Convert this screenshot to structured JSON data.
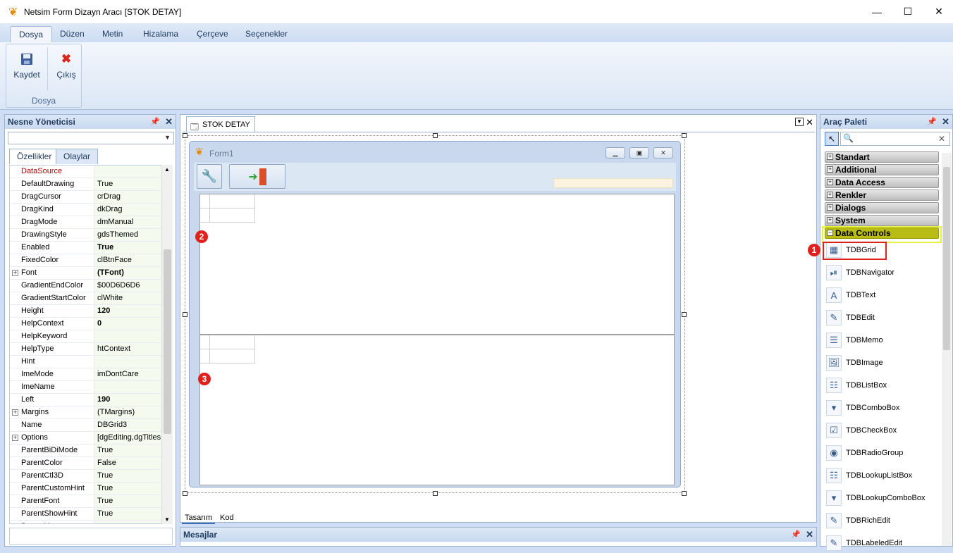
{
  "window": {
    "title": "Netsim Form Dizayn Aracı [STOK DETAY]",
    "minimize": "—",
    "maximize": "☐",
    "close": "✕"
  },
  "ribbon": {
    "tabs": [
      "Dosya",
      "Düzen",
      "Metin",
      "Hizalama",
      "Çerçeve",
      "Seçenekler"
    ],
    "active_tab": "Dosya",
    "group_label": "Dosya",
    "save_label": "Kaydet",
    "exit_label": "Çıkış"
  },
  "inspector": {
    "title": "Nesne Yöneticisi",
    "tab_properties": "Özellikler",
    "tab_events": "Olaylar",
    "properties": [
      {
        "name": "DataSource",
        "value": ""
      },
      {
        "name": "DefaultDrawing",
        "value": "True"
      },
      {
        "name": "DragCursor",
        "value": "crDrag"
      },
      {
        "name": "DragKind",
        "value": "dkDrag"
      },
      {
        "name": "DragMode",
        "value": "dmManual"
      },
      {
        "name": "DrawingStyle",
        "value": "gdsThemed"
      },
      {
        "name": "Enabled",
        "value": "True"
      },
      {
        "name": "FixedColor",
        "value": "clBtnFace"
      },
      {
        "name": "Font",
        "value": "(TFont)"
      },
      {
        "name": "GradientEndColor",
        "value": "$00D6D6D6"
      },
      {
        "name": "GradientStartColor",
        "value": "clWhite"
      },
      {
        "name": "Height",
        "value": "120"
      },
      {
        "name": "HelpContext",
        "value": "0"
      },
      {
        "name": "HelpKeyword",
        "value": ""
      },
      {
        "name": "HelpType",
        "value": "htContext"
      },
      {
        "name": "Hint",
        "value": ""
      },
      {
        "name": "ImeMode",
        "value": "imDontCare"
      },
      {
        "name": "ImeName",
        "value": ""
      },
      {
        "name": "Left",
        "value": "190"
      },
      {
        "name": "Margins",
        "value": "(TMargins)"
      },
      {
        "name": "Name",
        "value": "DBGrid3"
      },
      {
        "name": "Options",
        "value": "[dgEditing,dgTitles,"
      },
      {
        "name": "ParentBiDiMode",
        "value": "True"
      },
      {
        "name": "ParentColor",
        "value": "False"
      },
      {
        "name": "ParentCtl3D",
        "value": "True"
      },
      {
        "name": "ParentCustomHint",
        "value": "True"
      },
      {
        "name": "ParentFont",
        "value": "True"
      },
      {
        "name": "ParentShowHint",
        "value": "True"
      },
      {
        "name": "PopupMenu",
        "value": ""
      }
    ]
  },
  "designer": {
    "tab_label": "STOK DETAY",
    "form_caption": "Form1",
    "bottom_tab_design": "Tasarım",
    "bottom_tab_code": "Kod",
    "badge2": "2",
    "badge3": "3"
  },
  "messages": {
    "title": "Mesajlar"
  },
  "palette": {
    "title": "Araç Paleti",
    "categories": [
      "Standart",
      "Additional",
      "Data Access",
      "Renkler",
      "Dialogs",
      "System",
      "Data Controls"
    ],
    "open_category": "Data Controls",
    "badge1": "1",
    "items": [
      "TDBGrid",
      "TDBNavigator",
      "TDBText",
      "TDBEdit",
      "TDBMemo",
      "TDBImage",
      "TDBListBox",
      "TDBComboBox",
      "TDBCheckBox",
      "TDBRadioGroup",
      "TDBLookupListBox",
      "TDBLookupComboBox",
      "TDBRichEdit",
      "TDBLabeledEdit"
    ]
  },
  "colors": {
    "accent_red": "#e0201b",
    "highlight_yellow": "#e8f040",
    "ribbon_blue": "#cfdef5"
  }
}
